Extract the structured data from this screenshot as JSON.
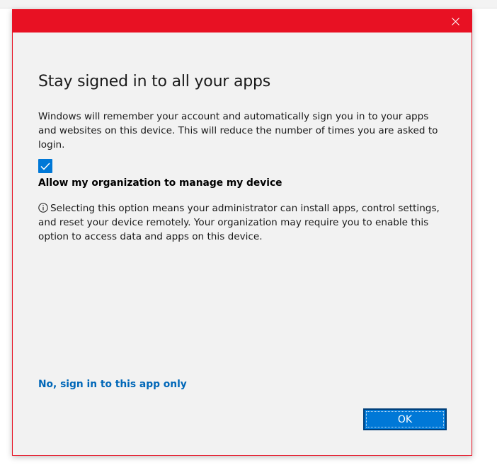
{
  "dialog": {
    "title": "Stay signed in to all your apps",
    "description": "Windows will remember your account and automatically sign you in to your apps and websites on this device. This will reduce the number of times you are asked to login.",
    "checkbox": {
      "checked": true,
      "label": "Allow my organization to manage my device"
    },
    "info_text": "Selecting this option means your administrator can install apps, control settings, and reset your device remotely. Your organization may require you to enable this option to access data and apps on this device.",
    "alt_link": "No, sign in to this app only",
    "ok_label": "OK"
  },
  "icons": {
    "close": "close-icon",
    "check": "checkmark-icon",
    "info": "info-icon"
  },
  "colors": {
    "titlebar": "#e81123",
    "accent": "#0078d7",
    "link": "#0067b8",
    "background": "#f2f2f2"
  }
}
